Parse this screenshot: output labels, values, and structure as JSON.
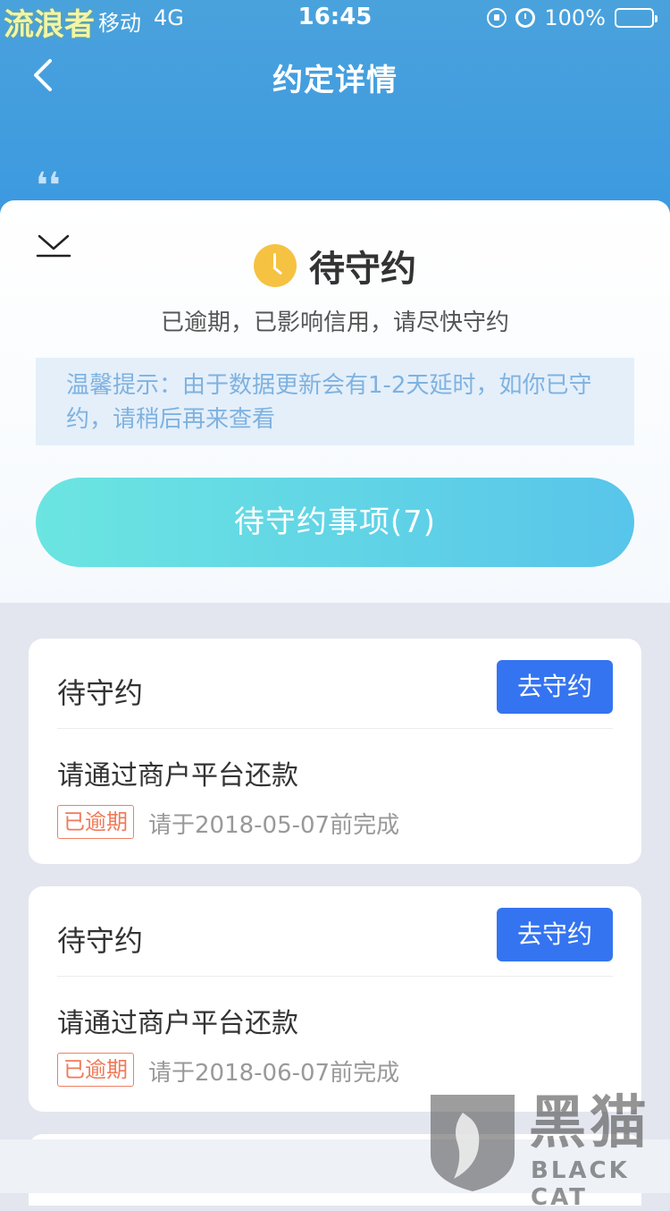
{
  "status_bar": {
    "carrier": "移动",
    "network": "4G",
    "time": "16:45",
    "battery": "100%"
  },
  "watermark_top": "流浪者",
  "nav": {
    "title": "约定详情",
    "back_icon": "chevron-left-icon"
  },
  "quote": "❛❛",
  "status": {
    "title": "待守约",
    "description": "已逾期，已影响信用，请尽快守约",
    "tip": "温馨提示：由于数据更新会有1-2天延时，如你已守约，请稍后再来查看",
    "button_label": "待守约事项(7)"
  },
  "cards": [
    {
      "title": "待守约",
      "action_label": "去守约",
      "task": "请通过商户平台还款",
      "badge": "已逾期",
      "deadline": "请于2018-05-07前完成"
    },
    {
      "title": "待守约",
      "action_label": "去守约",
      "task": "请通过商户平台还款",
      "badge": "已逾期",
      "deadline": "请于2018-06-07前完成"
    }
  ],
  "blackcat": {
    "cn": "黑猫",
    "en": "BLACK CAT"
  },
  "colors": {
    "header": "#3d9ae0",
    "primary_button": "#3574f0",
    "overdue": "#f07a58",
    "clock": "#f5c242"
  }
}
